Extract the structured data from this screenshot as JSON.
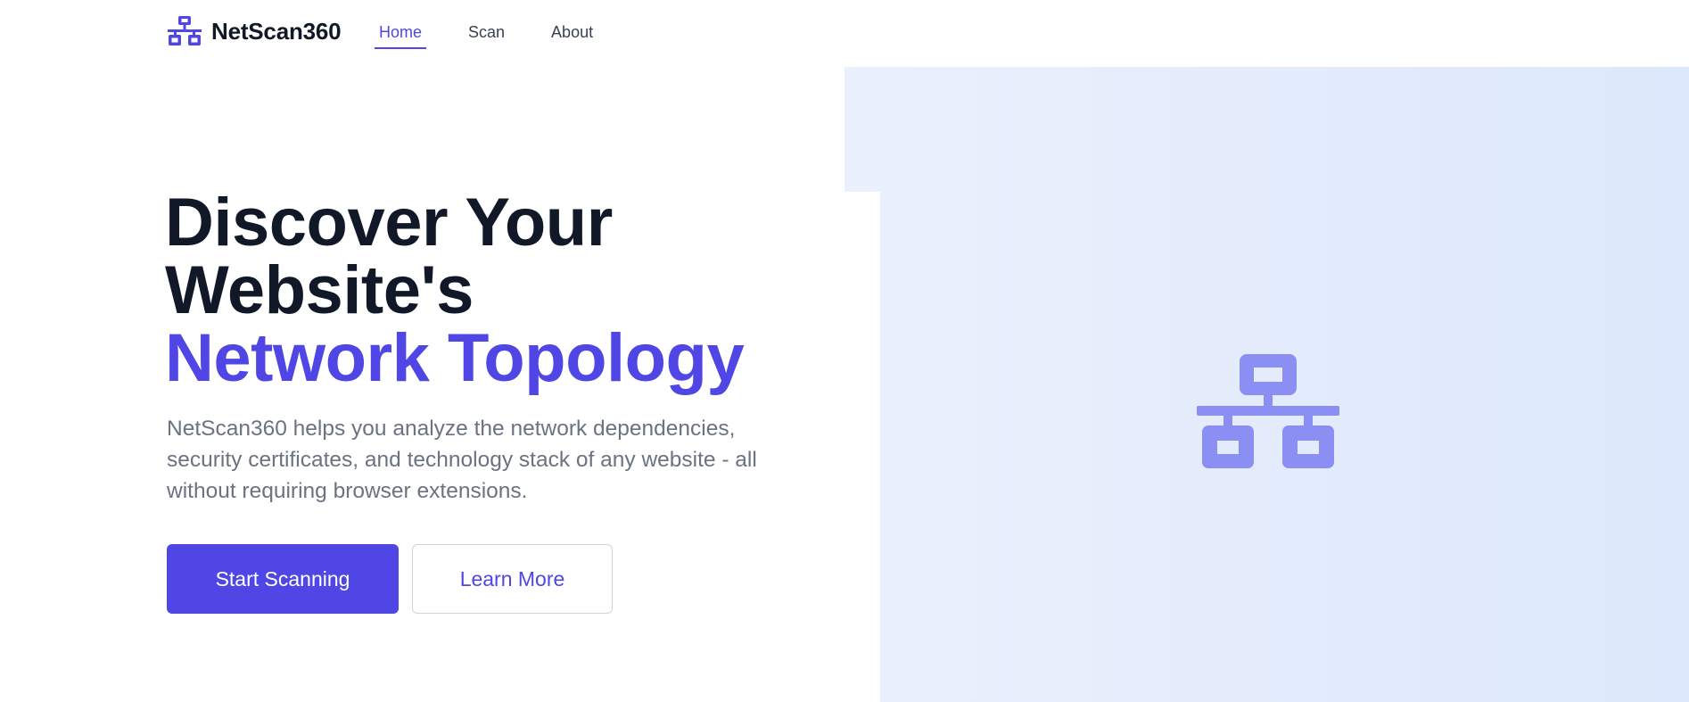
{
  "brand": {
    "name": "NetScan360",
    "icon": "network-icon"
  },
  "nav": {
    "items": [
      {
        "label": "Home",
        "active": true
      },
      {
        "label": "Scan",
        "active": false
      },
      {
        "label": "About",
        "active": false
      }
    ]
  },
  "hero": {
    "title_line1": "Discover Your",
    "title_line2": "Website's",
    "title_accent": "Network Topology",
    "description": "NetScan360 helps you analyze the network dependencies, security certificates, and technology stack of any website - all without requiring browser extensions.",
    "primary_button": "Start Scanning",
    "secondary_button": "Learn More",
    "illustration_icon": "network-icon"
  },
  "colors": {
    "accent": "#4f46e5",
    "heading": "#111827",
    "body_text": "#6b7280",
    "panel_gradient_start": "#ebf0fd",
    "panel_gradient_end": "#dce8fb",
    "illustration": "#8b8ff3"
  }
}
